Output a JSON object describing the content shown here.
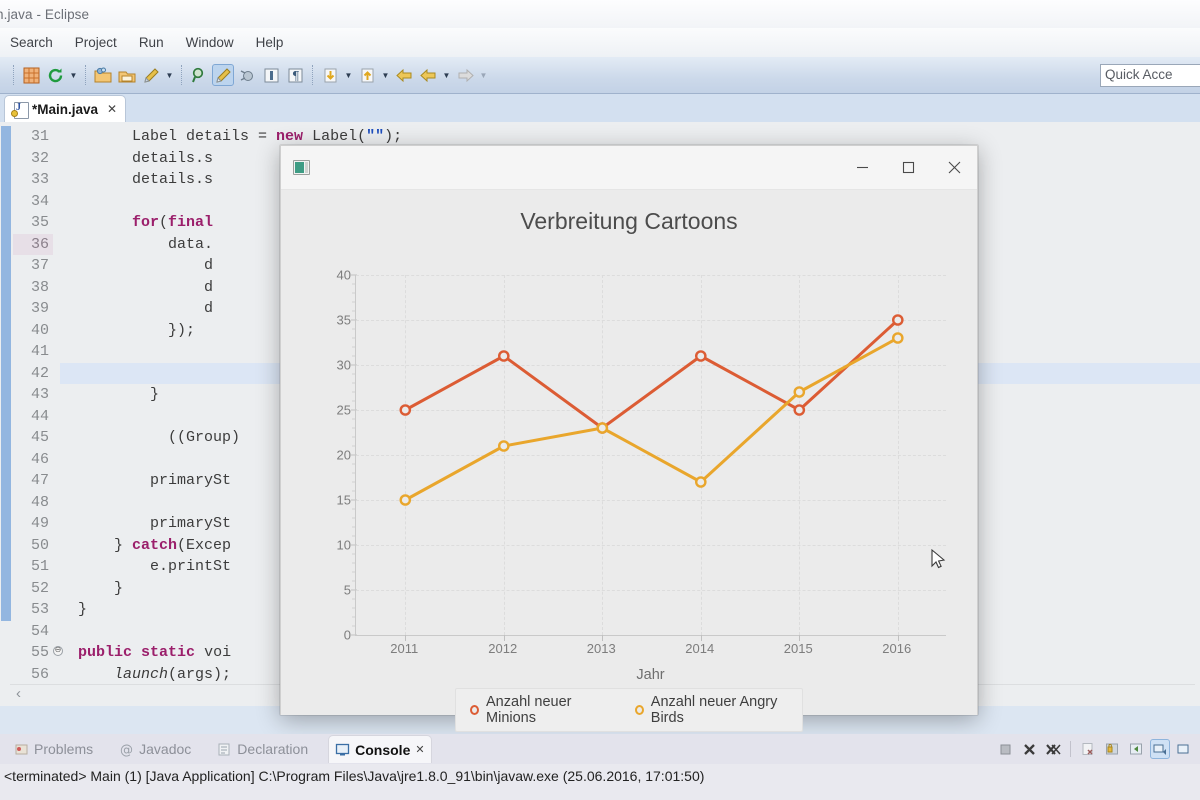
{
  "window": {
    "title": "n.java - Eclipse",
    "menu": [
      "Search",
      "Project",
      "Run",
      "Window",
      "Help"
    ],
    "quick_access": "Quick Acce"
  },
  "toolbar": {
    "icons": [
      {
        "name": "new-wizard-icon",
        "glyph": "⊞",
        "color": "#d4703a"
      },
      {
        "name": "refresh-icon",
        "glyph": "↻",
        "color": "#1f9b3e"
      },
      {
        "name": "refresh-dropdown-icon",
        "glyph": "▾",
        "color": "#2d3d52"
      },
      {
        "name": "open-type-icon",
        "glyph": "■",
        "color": "#e0a02a"
      },
      {
        "name": "save-icon",
        "glyph": "▬",
        "color": "#e0a02a"
      },
      {
        "name": "run-external-tools-icon",
        "glyph": "✒",
        "color": "#c9a227"
      },
      {
        "name": "run-external-dropdown-icon",
        "glyph": "▾",
        "color": "#2d3d52"
      },
      {
        "name": "search-icon",
        "glyph": "⌕",
        "color": "#3c7d46"
      },
      {
        "name": "build-icon",
        "glyph": "✒",
        "color": "#d6a62c"
      },
      {
        "name": "debug-icon",
        "glyph": "⚙",
        "color": "#8ba3b8"
      },
      {
        "name": "toggle-block-selection-icon",
        "glyph": "□",
        "color": "#44607e"
      },
      {
        "name": "show-whitespace-icon",
        "glyph": "¶",
        "color": "#44607e"
      },
      {
        "name": "next-annotation-icon",
        "glyph": "↓",
        "color": "#d1a533"
      },
      {
        "name": "next-annotation-dropdown-icon",
        "glyph": "▾",
        "color": "#2d3d52"
      },
      {
        "name": "previous-annotation-icon",
        "glyph": "↑",
        "color": "#d1a533"
      },
      {
        "name": "previous-annotation-dropdown-icon",
        "glyph": "▾",
        "color": "#2d3d52"
      },
      {
        "name": "last-edit-location-icon",
        "glyph": "⇦",
        "color": "#e0b03a"
      },
      {
        "name": "back-icon",
        "glyph": "⇦",
        "color": "#e0b03a"
      },
      {
        "name": "back-dropdown-icon",
        "glyph": "▾",
        "color": "#2d3d52"
      },
      {
        "name": "forward-icon",
        "glyph": "⇨",
        "color": "#c8c8c8"
      },
      {
        "name": "forward-dropdown-icon",
        "glyph": "▾",
        "color": "#9aa7b8"
      }
    ]
  },
  "editor": {
    "tab_label": "*Main.java",
    "tab_close": "✕",
    "first_line": 31,
    "highlighted_line": 36,
    "banded_line": 42,
    "fold_line": 55,
    "lines": [
      {
        "n": 31,
        "html": "        Label details = new Label(\"\");"
      },
      {
        "n": 32,
        "html": "        details.s"
      },
      {
        "n": 33,
        "html": "        details.s"
      },
      {
        "n": 34,
        "html": ""
      },
      {
        "n": 35,
        "html": "        for(final"
      },
      {
        "n": 36,
        "html": "            data."
      },
      {
        "n": 37,
        "html": "                d"
      },
      {
        "n": 38,
        "html": "                d"
      },
      {
        "n": 39,
        "html": "                d"
      },
      {
        "n": 40,
        "html": "            });"
      },
      {
        "n": 41,
        "html": ""
      },
      {
        "n": 42,
        "html": ""
      },
      {
        "n": 43,
        "html": "          }"
      },
      {
        "n": 44,
        "html": ""
      },
      {
        "n": 45,
        "html": "            ((Group)"
      },
      {
        "n": 46,
        "html": ""
      },
      {
        "n": 47,
        "html": "          primarySt"
      },
      {
        "n": 48,
        "html": ""
      },
      {
        "n": 49,
        "html": "          primarySt"
      },
      {
        "n": 50,
        "html": "      } catch(Excep"
      },
      {
        "n": 51,
        "html": "          e.printSt"
      },
      {
        "n": 52,
        "html": "      }"
      },
      {
        "n": 53,
        "html": "  }"
      },
      {
        "n": 54,
        "html": ""
      },
      {
        "n": 55,
        "html": "  public static voi"
      },
      {
        "n": 56,
        "html": "      launch(args);"
      }
    ]
  },
  "fxwindow": {
    "icon": "javafx-app-icon",
    "minimize": "─",
    "maximize": "□",
    "close": "✕"
  },
  "chart_data": {
    "type": "line",
    "title": "Verbreitung Cartoons",
    "xlabel": "Jahr",
    "ylabel": "",
    "categories": [
      "2011",
      "2012",
      "2013",
      "2014",
      "2015",
      "2016"
    ],
    "ylim": [
      0,
      40
    ],
    "ytick_step": 5,
    "yticks": [
      0,
      5,
      10,
      15,
      20,
      25,
      30,
      35,
      40
    ],
    "grid": true,
    "legend_position": "bottom",
    "series": [
      {
        "name": "Anzahl neuer Minions",
        "color": "#dc5c34",
        "values": [
          25,
          31,
          23,
          31,
          25,
          35
        ]
      },
      {
        "name": "Anzahl neuer Angry Birds",
        "color": "#e9a62c",
        "values": [
          15,
          21,
          23,
          17,
          27,
          33
        ]
      }
    ]
  },
  "bottom_panel": {
    "tabs": [
      {
        "label": "Problems",
        "icon": "problems-icon",
        "active": false
      },
      {
        "label": "Javadoc",
        "icon": "javadoc-icon",
        "active": false
      },
      {
        "label": "Declaration",
        "icon": "declaration-icon",
        "active": false
      },
      {
        "label": "Console",
        "icon": "console-icon",
        "active": true
      }
    ],
    "tab_close": "✕",
    "console_text": "<terminated> Main (1) [Java Application] C:\\Program Files\\Java\\jre1.8.0_91\\bin\\javaw.exe (25.06.2016, 17:01:50)",
    "tools": [
      {
        "name": "terminate-icon",
        "glyph": "■",
        "selected": false
      },
      {
        "name": "remove-launch-icon",
        "glyph": "✖",
        "selected": false
      },
      {
        "name": "remove-all-terminated-icon",
        "glyph": "✖",
        "selected": false
      },
      {
        "name": "clear-console-icon",
        "glyph": "⌧",
        "selected": false
      },
      {
        "name": "scroll-lock-icon",
        "glyph": "ὑ2",
        "selected": false
      },
      {
        "name": "pin-console-icon",
        "glyph": "↰",
        "selected": false
      },
      {
        "name": "display-selected-console-icon",
        "glyph": "☰",
        "selected": true
      },
      {
        "name": "open-console-icon",
        "glyph": "⊞",
        "selected": false
      }
    ]
  }
}
